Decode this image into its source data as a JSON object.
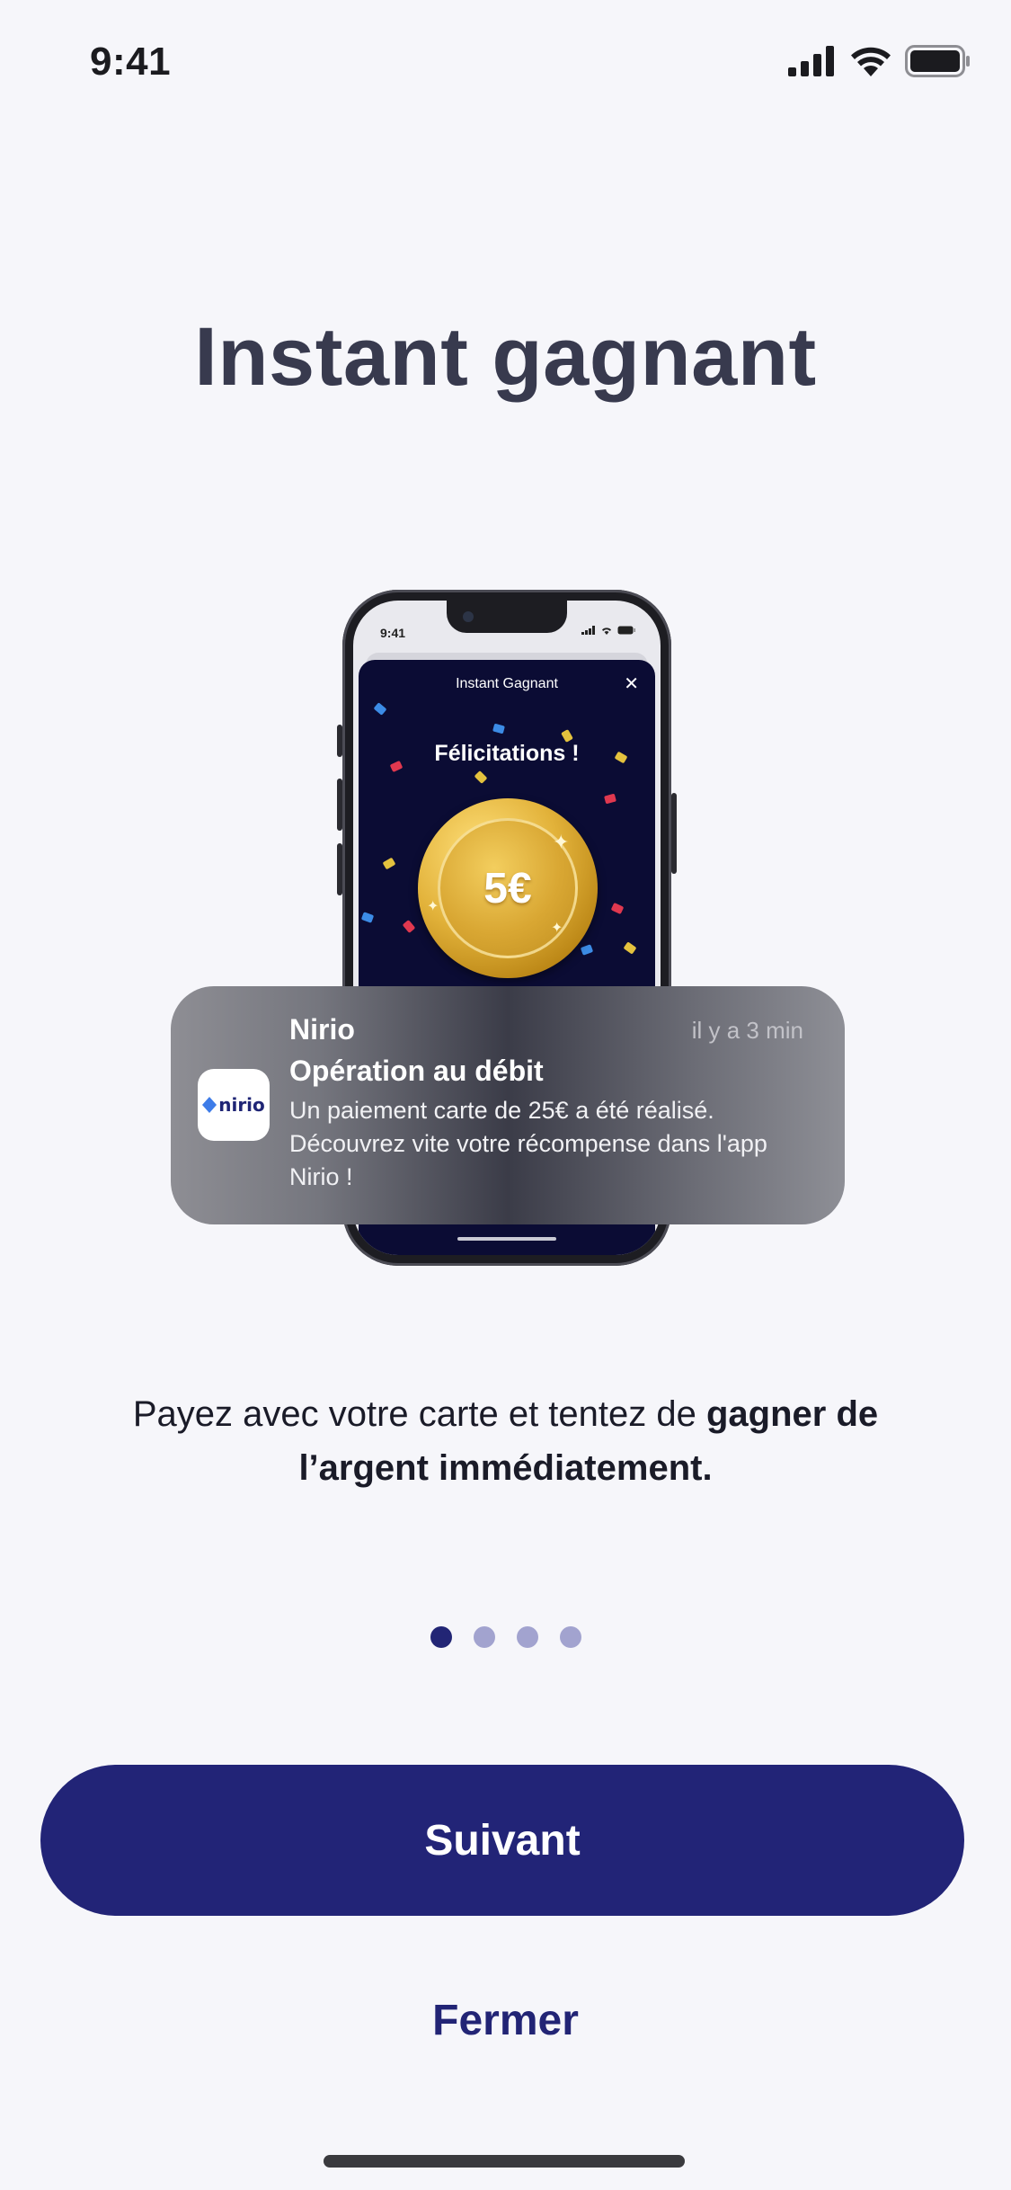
{
  "status_bar": {
    "time": "9:41",
    "icons": [
      "cellular-signal-icon",
      "wifi-icon",
      "battery-icon"
    ]
  },
  "title": "Instant gagnant",
  "phone_mockup": {
    "status_time": "9:41",
    "modal_header": "Instant Gagnant",
    "close_glyph": "✕",
    "congrats": "Félicitations !",
    "coin_value": "5€"
  },
  "notification": {
    "app_name": "Nirio",
    "logo_text": "nirio",
    "time": "il y a 3 min",
    "title": "Opération au débit",
    "body": "Un paiement carte de 25€ a été réalisé. Découvrez vite votre récompense dans l'app Nirio !"
  },
  "description": {
    "prefix": "Payez avec votre carte et tentez de ",
    "bold": "gagner de l’argent immédiatement."
  },
  "pager": {
    "total": 4,
    "active": 1
  },
  "buttons": {
    "next_label": "Suivant",
    "close_label": "Fermer"
  },
  "colors": {
    "primary": "#222477",
    "background": "#f6f6fa",
    "title": "#383a4e",
    "dot_active": "#222575",
    "dot_inactive": "#a2a3cf",
    "modal_bg": "#0b0c34",
    "coin_gold": "#d9a733"
  }
}
